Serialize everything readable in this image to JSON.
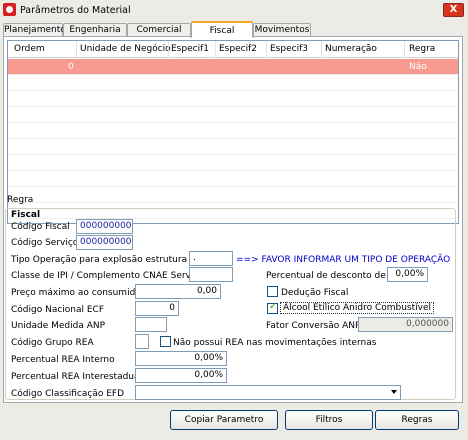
{
  "window": {
    "title": "Parâmetros do Material",
    "close_label": "X"
  },
  "tabs": [
    {
      "label": "Planejamento"
    },
    {
      "label": "Engenharia"
    },
    {
      "label": "Comercial"
    },
    {
      "label": "Fiscal",
      "active": true
    },
    {
      "label": "Movimentos"
    }
  ],
  "grid": {
    "columns": [
      "Ordem",
      "Unidade de Negócio",
      "Especif1",
      "Especif2",
      "Especif3",
      "Numeração",
      "Regra"
    ],
    "rows": [
      {
        "ordem": "0",
        "unidade": "",
        "especif1": "",
        "especif2": "",
        "especif3": "",
        "numeracao": "",
        "regra": "Não",
        "selected": true
      }
    ],
    "selected_row_color": "#f89a90"
  },
  "regra": {
    "group_label": "Regra",
    "fiscal_label": "Fiscal",
    "codigo_fiscal": {
      "label": "Código Fiscal",
      "value": "0000000000"
    },
    "codigo_servico": {
      "label": "Código Serviço",
      "value": "00000000000"
    },
    "tipo_operacao": {
      "label": "Tipo Operação para explosão estrutura com.",
      "value": ".",
      "warning": "==> FAVOR INFORMAR UM TIPO DE OPERAÇÃO"
    },
    "classe_ipi": {
      "label": "Classe de IPI / Complemento CNAE Serviço",
      "value": ""
    },
    "percentual_st": {
      "label": "Percentual de desconto de ST",
      "value": "0,00%"
    },
    "preco_maximo": {
      "label": "Preço máximo ao consumidor",
      "value": "0,00"
    },
    "deducao_fiscal": {
      "label": "Dedução Fiscal",
      "checked": false
    },
    "codigo_ecf": {
      "label": "Código Nacional ECF",
      "value": "0"
    },
    "alcool": {
      "label": "Álcool Etílico Anidro Combustível",
      "checked": true
    },
    "unidade_anp": {
      "label": "Unidade Medida ANP",
      "value": ""
    },
    "fator_anp": {
      "label": "Fator Conversão ANP",
      "value": "0,000000"
    },
    "grupo_rea": {
      "label": "Código Grupo REA",
      "value": ""
    },
    "nao_rea": {
      "label": "Não possui REA nas movimentações internas",
      "checked": false
    },
    "perc_rea_interno": {
      "label": "Percentual REA Interno",
      "value": "0,00%"
    },
    "perc_rea_interestadual": {
      "label": "Percentual REA Interestadual",
      "value": "0,00%"
    },
    "classificacao_efd": {
      "label": "Código Classificação EFD",
      "value": ""
    }
  },
  "buttons": {
    "copiar": "Copiar Parametro",
    "filtros": "Filtros",
    "regras": "Regras"
  },
  "colors": {
    "accent_tab": "#f5a623",
    "warning_text": "#0000cc",
    "close_button": "#d4351c"
  }
}
